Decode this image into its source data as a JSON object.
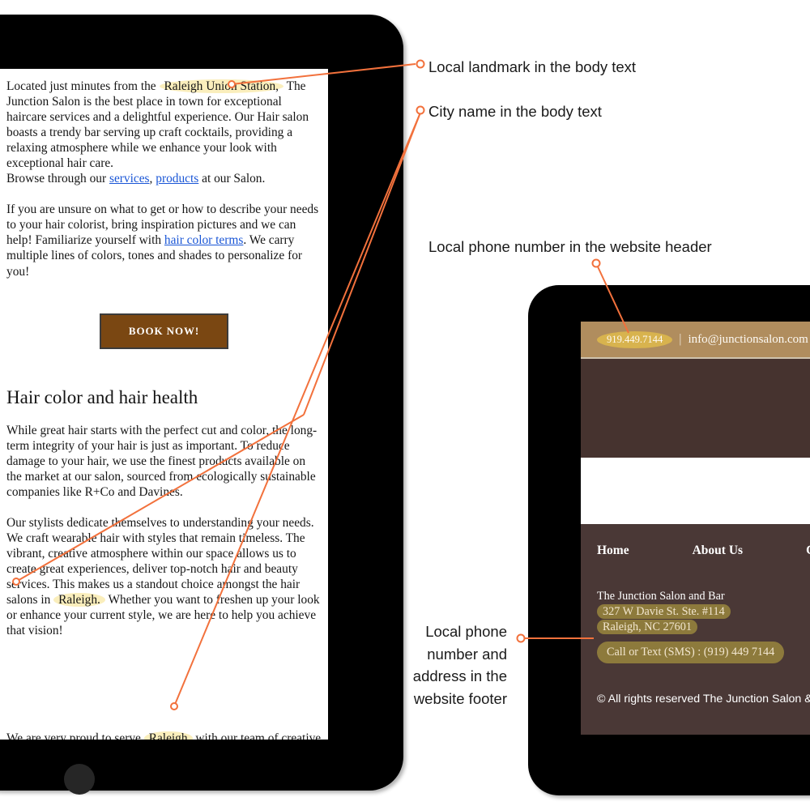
{
  "annotations": [
    {
      "id": "landmark",
      "label": "Local landmark in the body text"
    },
    {
      "id": "city",
      "label": "City name in the body text"
    },
    {
      "id": "phone_header",
      "label": "Local phone number in the website header"
    },
    {
      "id": "footer",
      "label": "Local phone number and address in the website footer"
    }
  ],
  "left_device": {
    "type": "tablet",
    "page": {
      "paragraph1": {
        "before": "Located just minutes from the ",
        "highlight": "Raleigh Union Station,",
        "after": " The Junction Salon is the best place in town for exceptional haircare services and a delightful experience. Our Hair salon boasts a trendy bar serving up craft cocktails, providing a relaxing atmosphere while we enhance your look with exceptional hair care."
      },
      "browse_line": {
        "before": "Browse through our ",
        "link1": "services",
        "mid": ", ",
        "link2": "products",
        "after": " at our Salon."
      },
      "paragraph2": {
        "before": "If you are unsure on what to get or how to describe your needs to your hair colorist, bring inspiration pictures and we can help! Familiarize yourself with ",
        "link": "hair color terms",
        "after": ". We carry multiple lines of colors, tones and shades to personalize for you!"
      },
      "cta_label": "BOOK NOW!",
      "section_heading": "Hair color and hair health",
      "paragraph3": "While great hair starts with the perfect cut and color, the long-term integrity of your hair is just as important. To reduce damage to your hair, we use the finest products available on the market at our salon, sourced from ecologically sustainable companies like R+Co and Davines.",
      "paragraph4": {
        "before": "Our stylists dedicate themselves to understanding your needs. We craft wearable hair with styles that remain timeless. The vibrant, creative atmosphere within our space allows us to create great experiences, deliver top-notch hair and beauty services. This makes us a standout choice amongst the hair salons in ",
        "highlight": "Raleigh.",
        "after": " Whether you want to freshen up your look or enhance your current style, we are here to help you achieve that vision!"
      },
      "paragraph5": {
        "before": "We are very proud to serve ",
        "highlight": "Raleigh",
        "after": " with our team of creative and"
      }
    }
  },
  "right_device": {
    "type": "tablet",
    "site": {
      "topbar": {
        "phone": "919.449.7144",
        "separator": "|",
        "email": "info@junctionsalon.com"
      },
      "footer_nav": [
        "Home",
        "About Us",
        "C"
      ],
      "footer": {
        "business_name": "The Junction Salon and Bar",
        "address_line1": "327 W Davie St. Ste. #114",
        "address_line2": "Raleigh, NC 27601",
        "sms_line": "Call or Text (SMS) : (919) 449 7144",
        "copyright": "© All rights reserved The Junction Salon & Bar"
      }
    }
  },
  "colors": {
    "annotation": "#f2713c",
    "highlight_light": "#faeebc",
    "highlight_dark": "#8d7a3c",
    "cta_brown": "#7a4712",
    "topbar_tan": "#b08d5e",
    "topbar_pill": "#d8b34e",
    "hero_brown": "#46332f",
    "footer_brown": "#4a3836",
    "link_blue": "#1a56d6"
  }
}
